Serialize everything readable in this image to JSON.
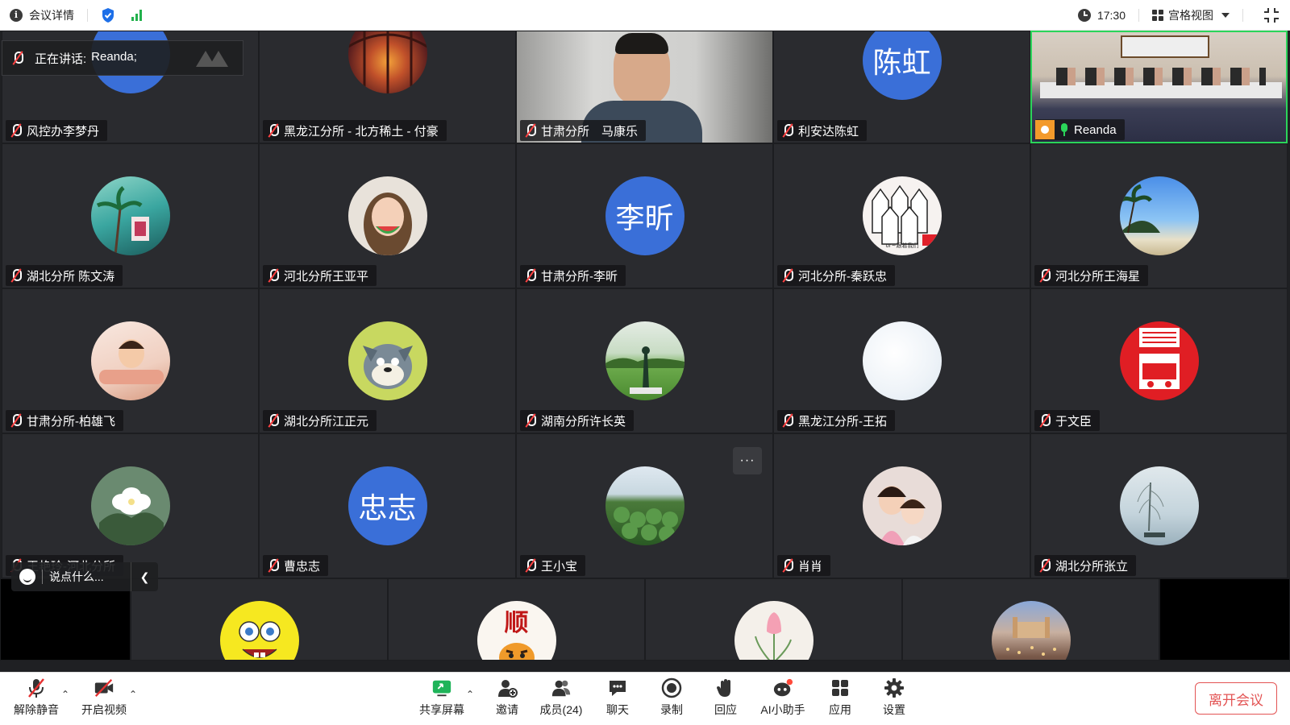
{
  "topbar": {
    "meeting_details": "会议详情",
    "time": "17:30",
    "view_mode": "宫格视图"
  },
  "speaking": {
    "label": "正在讲话:",
    "name": "Reanda;"
  },
  "tiles": [
    {
      "name": "风控办李梦丹",
      "avatar": "blue-circle",
      "color": "#3a6fd8"
    },
    {
      "name": "黑龙江分所 - 北方稀土 - 付豪",
      "avatar": "photo-sunset"
    },
    {
      "name": "甘肃分所　马康乐",
      "avatar": "video-man"
    },
    {
      "name": "利安达陈虹",
      "avatar_text": "陈虹",
      "color": "#3a6fd8"
    },
    {
      "name": "Reanda",
      "avatar": "video-conference-room",
      "active": true
    },
    {
      "name": "湖北分所 陈文涛",
      "avatar": "photo-palm"
    },
    {
      "name": "河北分所王亚平",
      "avatar": "photo-girl"
    },
    {
      "name": "甘肃分所-李昕",
      "avatar_text": "李昕",
      "color": "#3a6fd8"
    },
    {
      "name": "河北分所-秦跃忠",
      "avatar": "photo-cartoon-birds",
      "avatar_caption": "or~跟着我们"
    },
    {
      "name": "河北分所王海星",
      "avatar": "photo-beach"
    },
    {
      "name": "甘肃分所-柏雄飞",
      "avatar": "photo-baby"
    },
    {
      "name": "湖北分所江正元",
      "avatar": "photo-tom-cat"
    },
    {
      "name": "湖南分所许长英",
      "avatar": "photo-golf"
    },
    {
      "name": "黑龙江分所-王拓",
      "avatar": "photo-white"
    },
    {
      "name": "于文臣",
      "avatar": "photo-red-poster"
    },
    {
      "name": "王艳玲-河北分所",
      "avatar": "photo-flower"
    },
    {
      "name": "曹忠志",
      "avatar_text": "忠志",
      "color": "#3a6fd8"
    },
    {
      "name": "王小宝",
      "avatar": "photo-field"
    },
    {
      "name": "肖肖",
      "avatar": "photo-kids"
    },
    {
      "name": "湖北分所张立",
      "avatar": "photo-lake"
    },
    {
      "name": "",
      "avatar": "photo-spongebob"
    },
    {
      "name": "",
      "avatar": "photo-tiger",
      "avatar_text": "顺"
    },
    {
      "name": "",
      "avatar": "photo-tulip"
    },
    {
      "name": "",
      "avatar": "photo-city"
    }
  ],
  "chat": {
    "placeholder": "说点什么..."
  },
  "more_button": "···",
  "toolbar": {
    "unmute": "解除静音",
    "start_video": "开启视频",
    "share_screen": "共享屏幕",
    "invite": "邀请",
    "members": "成员(24)",
    "chat": "聊天",
    "record": "录制",
    "reaction": "回应",
    "ai_assistant": "AI小助手",
    "apps": "应用",
    "settings": "设置",
    "leave": "离开会议"
  }
}
